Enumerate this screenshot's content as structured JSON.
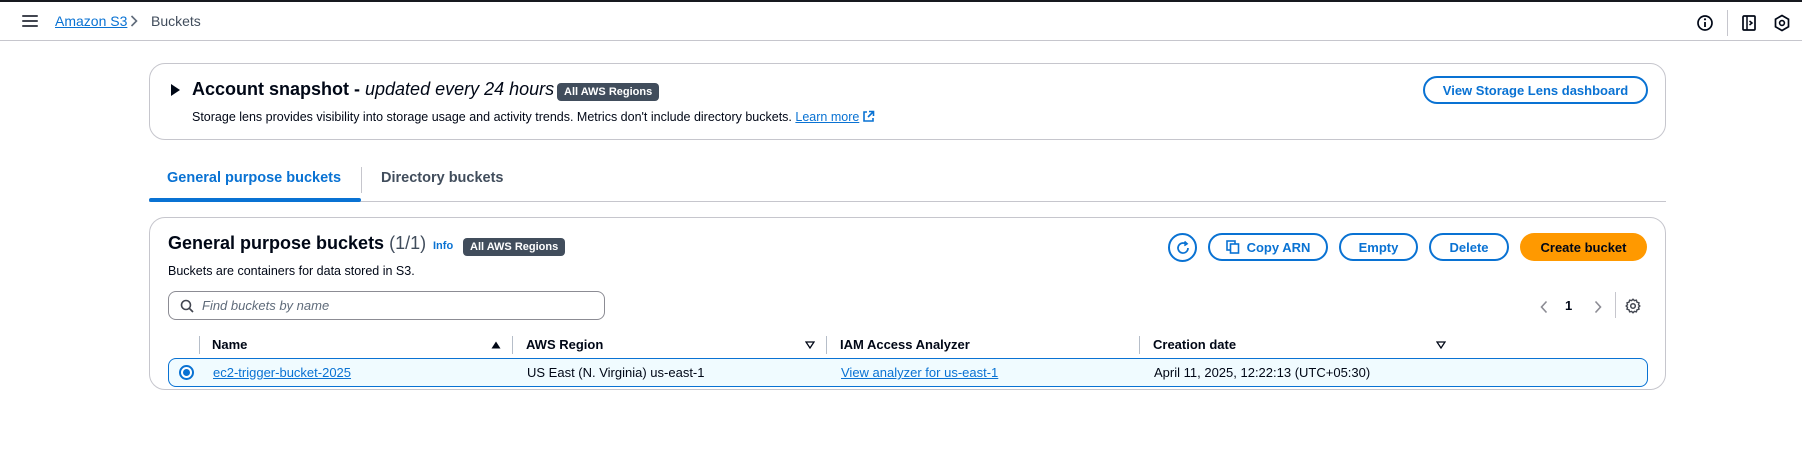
{
  "header": {
    "breadcrumb": {
      "service": "Amazon S3",
      "current": "Buckets"
    },
    "icons": [
      "menu-icon",
      "info-circle-icon",
      "notifications-panel-icon",
      "settings-hexagon-icon"
    ]
  },
  "snapshot": {
    "title_bold": "Account snapshot - ",
    "title_italic": "updated every 24 hours",
    "badge": "All AWS Regions",
    "description": "Storage lens provides visibility into storage usage and activity trends. Metrics don't include directory buckets.",
    "learn_more": "Learn more",
    "button": "View Storage Lens dashboard"
  },
  "tabs": [
    {
      "label": "General purpose buckets",
      "active": true
    },
    {
      "label": "Directory buckets",
      "active": false
    }
  ],
  "buckets_panel": {
    "title": "General purpose buckets",
    "count": "(1/1)",
    "info": "Info",
    "badge": "All AWS Regions",
    "description": "Buckets are containers for data stored in S3.",
    "buttons": {
      "copy_arn": "Copy ARN",
      "empty": "Empty",
      "delete": "Delete",
      "create": "Create bucket"
    },
    "search_placeholder": "Find buckets by name",
    "pagination": {
      "current_page": "1"
    },
    "columns": [
      "Name",
      "AWS Region",
      "IAM Access Analyzer",
      "Creation date"
    ],
    "rows": [
      {
        "selected": true,
        "name": "ec2-trigger-bucket-2025",
        "region": "US East (N. Virginia) us-east-1",
        "analyzer": "View analyzer for us-east-1",
        "created": "April 11, 2025, 12:22:13 (UTC+05:30)"
      }
    ]
  },
  "colors": {
    "link": "#0972d3",
    "primary_button": "#ff9900",
    "badge": "#414d5c",
    "text": "#000716"
  }
}
